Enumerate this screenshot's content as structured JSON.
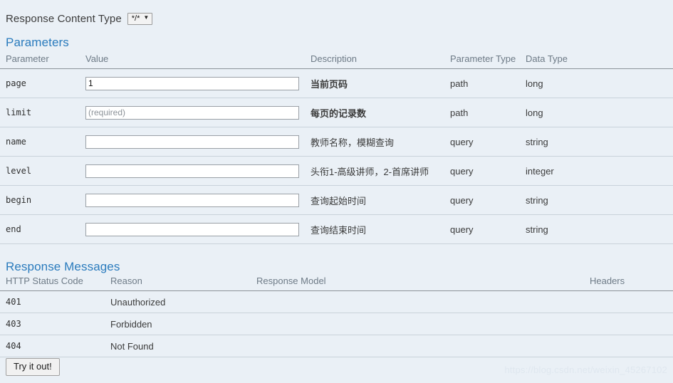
{
  "content_type": {
    "label": "Response Content Type",
    "selected": "*/*",
    "caret_icon": "chevron-down-icon"
  },
  "parameters_section": {
    "heading": "Parameters",
    "columns": {
      "parameter": "Parameter",
      "value": "Value",
      "description": "Description",
      "parameter_type": "Parameter Type",
      "data_type": "Data Type"
    },
    "rows": [
      {
        "parameter": "page",
        "value": "1",
        "placeholder": "",
        "description": "当前页码",
        "required": true,
        "parameter_type": "path",
        "data_type": "long"
      },
      {
        "parameter": "limit",
        "value": "",
        "placeholder": "(required)",
        "description": "每页的记录数",
        "required": true,
        "parameter_type": "path",
        "data_type": "long"
      },
      {
        "parameter": "name",
        "value": "",
        "placeholder": "",
        "description": "教师名称，模糊查询",
        "required": false,
        "parameter_type": "query",
        "data_type": "string"
      },
      {
        "parameter": "level",
        "value": "",
        "placeholder": "",
        "description": "头衔1-高级讲师，2-首席讲师",
        "required": false,
        "parameter_type": "query",
        "data_type": "integer"
      },
      {
        "parameter": "begin",
        "value": "",
        "placeholder": "",
        "description": "查询起始时间",
        "required": false,
        "parameter_type": "query",
        "data_type": "string"
      },
      {
        "parameter": "end",
        "value": "",
        "placeholder": "",
        "description": "查询结束时间",
        "required": false,
        "parameter_type": "query",
        "data_type": "string"
      }
    ]
  },
  "response_messages_section": {
    "heading": "Response Messages",
    "columns": {
      "status_code": "HTTP Status Code",
      "reason": "Reason",
      "response_model": "Response Model",
      "headers": "Headers"
    },
    "rows": [
      {
        "status_code": "401",
        "reason": "Unauthorized",
        "response_model": "",
        "headers": ""
      },
      {
        "status_code": "403",
        "reason": "Forbidden",
        "response_model": "",
        "headers": ""
      },
      {
        "status_code": "404",
        "reason": "Not Found",
        "response_model": "",
        "headers": ""
      }
    ]
  },
  "actions": {
    "try_it_out": "Try it out!"
  },
  "watermark": "https://blog.csdn.net/weixin_45267102",
  "colors": {
    "background": "#eaf0f6",
    "heading": "#2a7bbd",
    "header_text": "#6d7a86",
    "body_text": "#3b3b3b",
    "row_divider": "#c9d2da",
    "head_divider": "#8c9399",
    "input_border": "#9aa0a6",
    "watermark": "#dfe7ef"
  }
}
